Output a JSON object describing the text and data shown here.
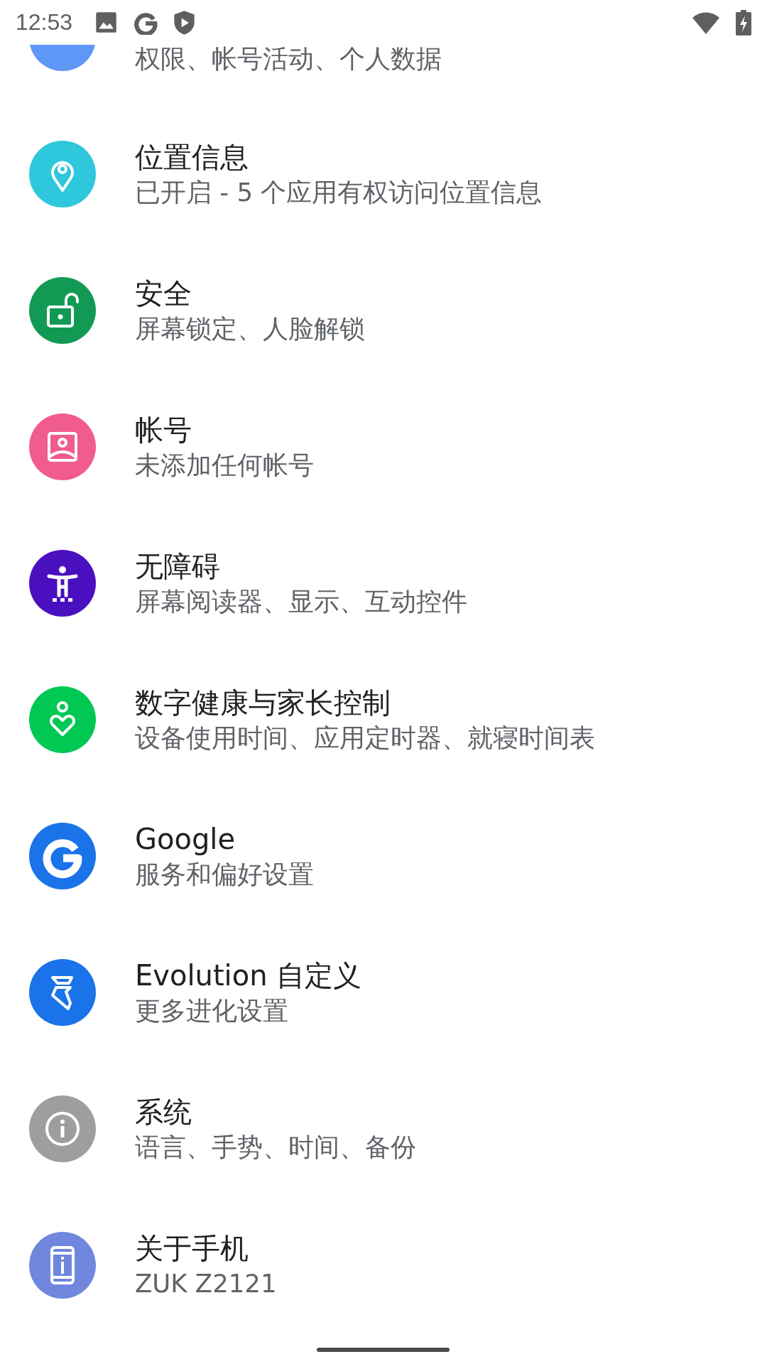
{
  "status_bar": {
    "time": "12:53"
  },
  "settings": [
    {
      "subtitle": "权限、帐号活动、个人数据",
      "color": "#5e97f6"
    },
    {
      "title": "位置信息",
      "subtitle": "已开启 - 5 个应用有权访问位置信息",
      "color": "#2ec7dc"
    },
    {
      "title": "安全",
      "subtitle": "屏幕锁定、人脸解锁",
      "color": "#129a54"
    },
    {
      "title": "帐号",
      "subtitle": "未添加任何帐号",
      "color": "#f05c8c"
    },
    {
      "title": "无障碍",
      "subtitle": "屏幕阅读器、显示、互动控件",
      "color": "#4a10c0"
    },
    {
      "title": "数字健康与家长控制",
      "subtitle": "设备使用时间、应用定时器、就寝时间表",
      "color": "#00c853"
    },
    {
      "title": "Google",
      "subtitle": "服务和偏好设置",
      "color": "#1a73e8"
    },
    {
      "title": "Evolution 自定义",
      "subtitle": "更多进化设置",
      "color": "#1a73e8"
    },
    {
      "title": "系统",
      "subtitle": "语言、手势、时间、备份",
      "color": "#9e9e9e"
    },
    {
      "title": "关于手机",
      "subtitle": "ZUK Z2121",
      "color": "#7087dd"
    }
  ]
}
